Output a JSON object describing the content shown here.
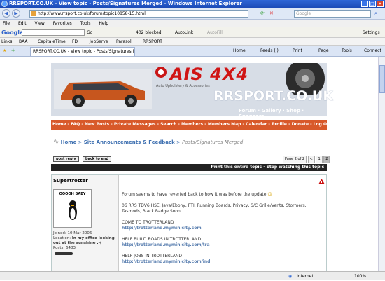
{
  "window": {
    "title": "RRSPORT.CO.UK - View topic - Posts/Signatures Merged - Windows Internet Explorer"
  },
  "address": {
    "url": "http://www.rrsport.co.uk/forum/topic10858-15.html",
    "search_placeholder": "Google"
  },
  "menu": [
    "File",
    "Edit",
    "View",
    "Favorites",
    "Tools",
    "Help"
  ],
  "google_bar": {
    "logo": "Google",
    "go": "Go",
    "blocked": "402 blocked",
    "autolink": "AutoLink",
    "autofill": "AutoFill",
    "settings": "Settings"
  },
  "links_bar": {
    "label": "Links",
    "items": [
      "BAA",
      "Capita eTime",
      "FD",
      "JobServe",
      "Parasol",
      "RRSPORT"
    ]
  },
  "tab": {
    "label": "RRSPORT.CO.UK - View topic - Posts/Signatures Merged"
  },
  "toolbar": {
    "home": "Home",
    "feeds": "Feeds (J)",
    "print": "Print",
    "page": "Page",
    "tools": "Tools",
    "connect": "Connect"
  },
  "banner": {
    "ais": "AIS 4X4",
    "tagline": "Auto Upholstery & Accessories",
    "site": "RRSPORT.CO.UK",
    "forum_links": "Forum · Gallery · Shop · Sponsors"
  },
  "nav": {
    "text": "Home - FAQ - New Posts - Private Messages - Search - Members - Members Map - Calendar - Profile - Donate - Log Out [shmoogle]"
  },
  "breadcrumb": {
    "home": "Home",
    "sep1": ">",
    "section": "Site Announcements & Feedback",
    "sep2": ">",
    "topic": "Posts/Signatures Merged"
  },
  "buttons": {
    "post_reply": "post reply",
    "back_to_end": "back to end"
  },
  "pager": {
    "label": "Page 2 of 2",
    "prev": "<",
    "p1": "1",
    "p2": "2"
  },
  "topic_bar": {
    "text": "Print this entire topic · Stop watching this topic"
  },
  "post": {
    "username": "Supertrotter",
    "avatar_text": "OOOOH BABY",
    "joined": "Joined: 10 Mar 2006",
    "location_label": "Location:",
    "location": "In my office looking out at the sunshine :-(",
    "posts": "Posts: 6483",
    "line1": "Forum seems to have reverted back to how it was before the update",
    "sig1": "06 RRS TDV6 HSE, Java/Ebony, PTI, Running Boards, Privacy, S/C Grille/Vents, Stormers, Tasmods, Black Badge Soon...",
    "sig2": "COME TO TROTTERLAND",
    "link1": "http://trotterland.myminicity.com",
    "sig3": "HELP BUILD ROADS IN TROTTERLAND",
    "link2": "http://trotterland.myminicity.com/tra",
    "sig4": "HELP JOBS IN TROTTERLAND",
    "link3": "http://trotterland.myminicity.com/ind"
  },
  "status": {
    "zone": "Internet",
    "zoom": "100%"
  }
}
